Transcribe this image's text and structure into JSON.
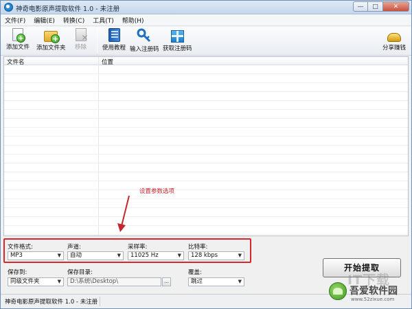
{
  "window": {
    "title": "神奇电影原声提取软件 1.0 - 未注册",
    "controls": {
      "minimize": "—",
      "maximize": "□",
      "close": "✕"
    }
  },
  "menu": {
    "items": [
      "文件(F)",
      "编辑(E)",
      "转换(C)",
      "工具(T)",
      "帮助(H)"
    ]
  },
  "toolbar": {
    "add_file": "添加文件",
    "add_folder": "添加文件夹",
    "remove": "移除",
    "tutorial": "使用教程",
    "enter_code": "输入注册码",
    "get_code": "获取注册码",
    "share": "分享赚钱"
  },
  "filelist": {
    "columns": [
      "文件名",
      "位置"
    ]
  },
  "annotation": {
    "text": "设置参数选项",
    "color": "#c4262e"
  },
  "settings": {
    "format_label": "文件格式:",
    "format_value": "MP3",
    "channel_label": "声道:",
    "channel_value": "自动",
    "samplerate_label": "采样率:",
    "samplerate_value": "11025 Hz",
    "bitrate_label": "比特率:",
    "bitrate_value": "128 kbps",
    "saveto_label": "保存到:",
    "saveto_value": "同级文件夹",
    "savedir_label": "保存目录:",
    "savedir_value": "D:\\系统\\Desktop\\",
    "overwrite_label": "覆盖:",
    "overwrite_value": "跳过",
    "browse": "..."
  },
  "start_button": "开始提取",
  "statusbar": {
    "text": "神奇电影原声提取软件 1.0 - 未注册"
  },
  "watermark": {
    "faded": "IT下载",
    "name": "吾爱软件园",
    "url": "www.52zixue.com"
  }
}
